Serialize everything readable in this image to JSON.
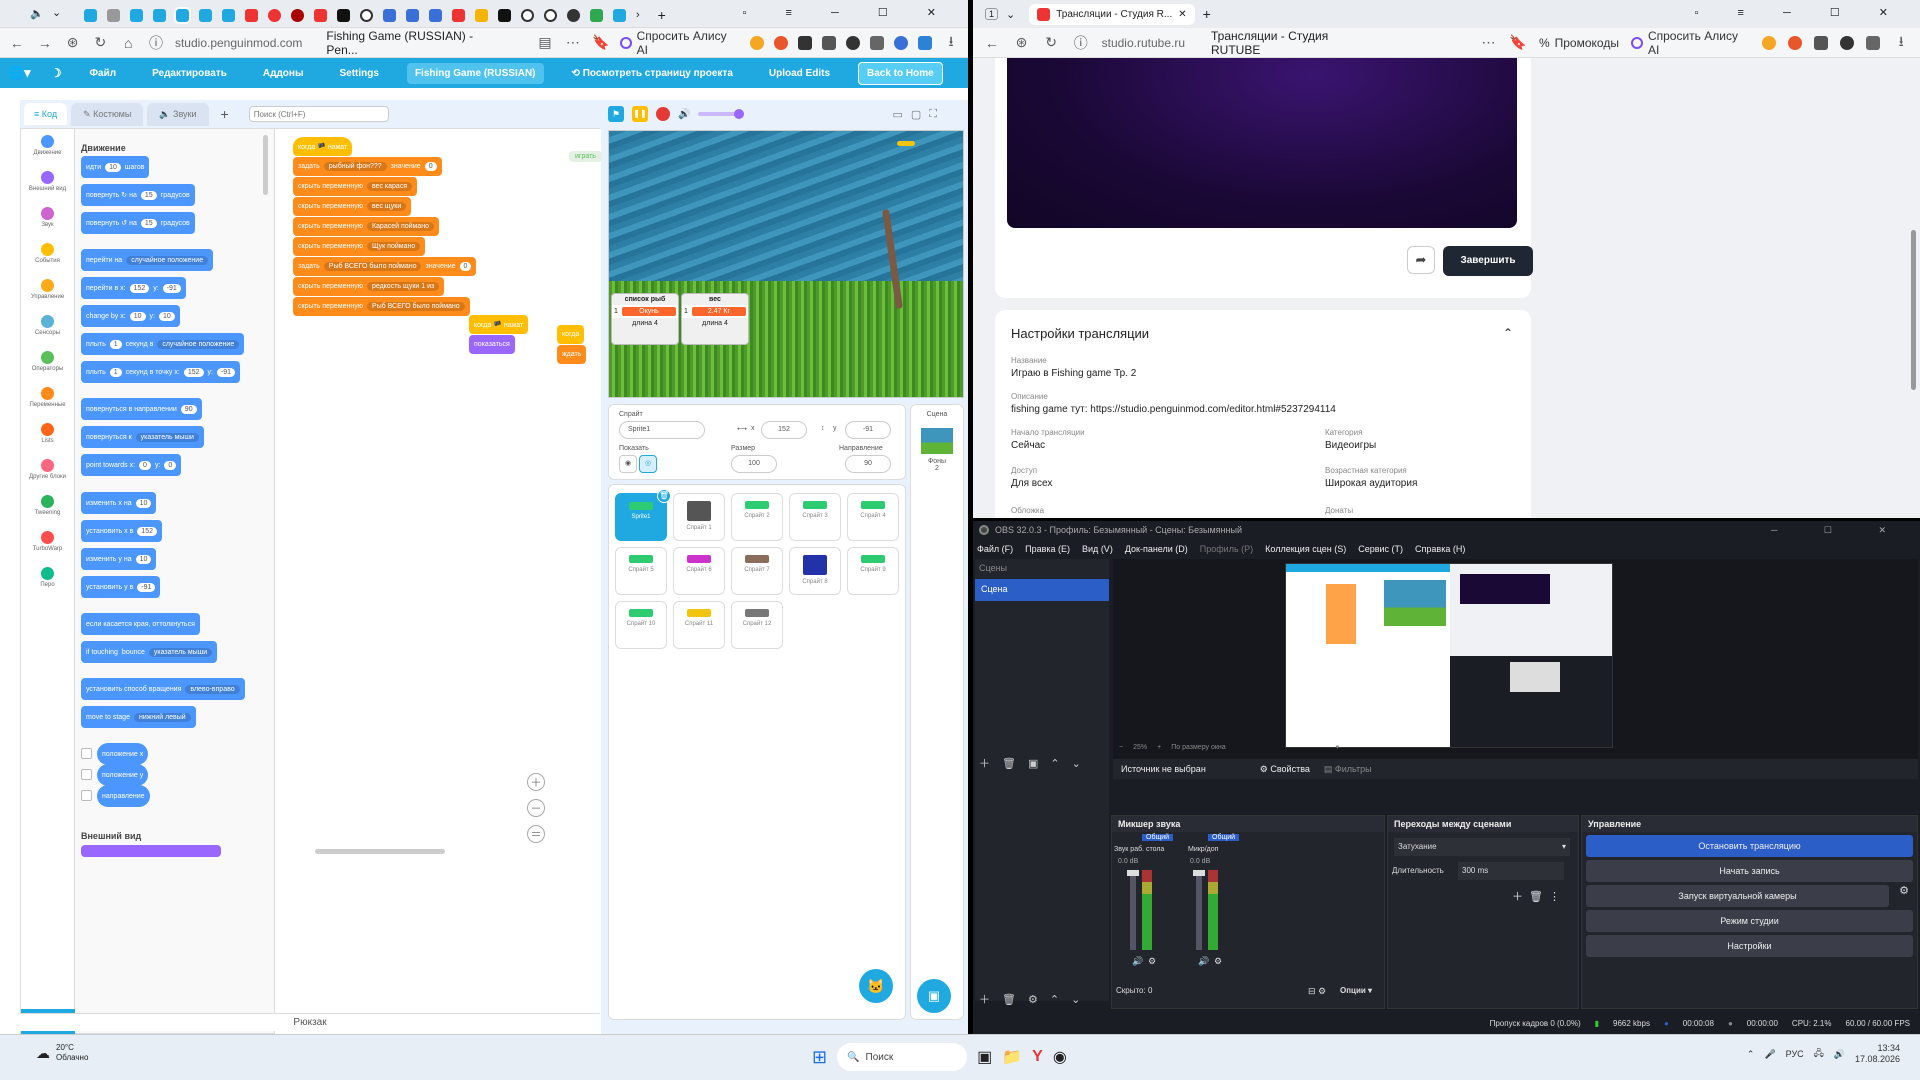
{
  "left_browser": {
    "tab_count_hint": "",
    "url": "studio.penguinmod.com",
    "page_title": "Fishing Game (RUSSIAN) - Pen...",
    "ask_alice": "Спросить Алису AI",
    "menu": {
      "file": "Файл",
      "edit": "Редактировать",
      "addons": "Аддоны",
      "settings": "Settings",
      "project_title": "Fishing Game (RUSSIAN)",
      "project_page": "Посмотреть страницу проекта",
      "upload": "Upload Edits",
      "back_home": "Back to Home"
    },
    "tabs": {
      "code": "Код",
      "costumes": "Костюмы",
      "sounds": "Звуки"
    },
    "search_placeholder": "Поиск (Ctrl+F)",
    "categories": [
      {
        "label": "Движение",
        "color": "#4c97ff"
      },
      {
        "label": "Внешний вид",
        "color": "#9966ff"
      },
      {
        "label": "Звук",
        "color": "#cf63cf"
      },
      {
        "label": "События",
        "color": "#ffbf00"
      },
      {
        "label": "Управление",
        "color": "#ffab19"
      },
      {
        "label": "Сенсоры",
        "color": "#5cb1d6"
      },
      {
        "label": "Операторы",
        "color": "#59c059"
      },
      {
        "label": "Переменные",
        "color": "#ff8c1a"
      },
      {
        "label": "Lists",
        "color": "#ff661a"
      },
      {
        "label": "Другие блоки",
        "color": "#ff6680"
      },
      {
        "label": "Tweening",
        "color": "#29b35b"
      },
      {
        "label": "TurboWarp",
        "color": "#ff4c4c"
      },
      {
        "label": "Перо",
        "color": "#0fbd8c"
      }
    ],
    "palette_heading": "Движение",
    "palette_blocks": [
      {
        "text": "идти",
        "v1": "10",
        "t2": "шагов"
      },
      {
        "text": "повернуть ↻ на",
        "v1": "15",
        "t2": "градусов"
      },
      {
        "text": "повернуть ↺ на",
        "v1": "15",
        "t2": "градусов"
      },
      {
        "text": "перейти на",
        "dd": "случайное положение"
      },
      {
        "text": "перейти в x:",
        "v1": "152",
        "t2": "y:",
        "v2": "-91"
      },
      {
        "text": "change by x:",
        "v1": "10",
        "t2": "y:",
        "v2": "10"
      },
      {
        "text": "плыть",
        "v1": "1",
        "t2": "секунд в",
        "dd": "случайное положение"
      },
      {
        "text": "плыть",
        "v1": "1",
        "t2": "секунд в точку x:",
        "v2": "152",
        "t3": "y:",
        "v3": "-91"
      },
      {
        "text": "повернуться в направлении",
        "v1": "90"
      },
      {
        "text": "повернуться к",
        "dd": "указатель мыши"
      },
      {
        "text": "point towards x:",
        "v1": "0",
        "t2": "y:",
        "v2": "0"
      },
      {
        "text": "изменить х на",
        "v1": "10"
      },
      {
        "text": "установить х в",
        "v1": "152"
      },
      {
        "text": "изменить у на",
        "v1": "10"
      },
      {
        "text": "установить у в",
        "v1": "-91"
      },
      {
        "text": "если касается края, оттолкнуться"
      },
      {
        "text": "if touching",
        "dd": "указатель мыши",
        "t2": "bounce"
      },
      {
        "text": "установить способ вращения",
        "dd": "влево-вправо"
      },
      {
        "text": "move to stage",
        "dd": "нижний левый"
      },
      {
        "text": "положение х"
      },
      {
        "text": "положение у"
      },
      {
        "text": "направление"
      }
    ],
    "palette_footer": "Внешний вид",
    "script": [
      {
        "text": "когда 🏴 нажат",
        "kind": "event"
      },
      {
        "text": "задать",
        "dd": "рыбный фон???",
        "t2": "значение",
        "v": "0"
      },
      {
        "text": "скрыть переменную",
        "dd": "вес карася"
      },
      {
        "text": "скрыть переменную",
        "dd": "вес щуки"
      },
      {
        "text": "скрыть переменную",
        "dd": "Карасей поймано"
      },
      {
        "text": "скрыть переменную",
        "dd": "Щук поймано"
      },
      {
        "text": "задать",
        "dd": "Рыб ВСЕГО было поймано",
        "t2": "значение",
        "v": "0"
      },
      {
        "text": "скрыть переменную",
        "dd": "редкость щуки 1 из"
      },
      {
        "text": "скрыть переменную",
        "dd": "Рыб ВСЕГО было поймано"
      }
    ],
    "script2": {
      "hat": "когда 🏴 нажат",
      "body": "показаться"
    },
    "script3": {
      "hat": "когда",
      "body": "ждать"
    },
    "play_tag": "играть",
    "monitors": {
      "list1_title": "список рыб",
      "list1_item": "Окунь",
      "list1_len": "длина 4",
      "list2_title": "вес",
      "list2_item": "2.47 Кг",
      "list2_len": "длина 4",
      "idx": "1"
    },
    "sprite_info": {
      "sprite_label": "Спрайт",
      "sprite_name": "Sprite1",
      "x_label": "x",
      "x_value": "152",
      "y_label": "y",
      "y_value": "-91",
      "show_label": "Показать",
      "size_label": "Размер",
      "size_value": "100",
      "dir_label": "Направление",
      "dir_value": "90",
      "stage_label": "Сцена",
      "backdrops_label": "Фоны",
      "backdrops_count": "2"
    },
    "sprites": [
      "Sprite1",
      "Спрайт 1",
      "Спрайт 2",
      "Спрайт 3",
      "Спрайт 4",
      "Спрайт 5",
      "Спрайт 6",
      "Спрайт 7",
      "Спрайт 8",
      "Спрайт 9",
      "Спрайт 10",
      "Спрайт 11",
      "Спрайт 12"
    ],
    "backpack": "Рюкзак"
  },
  "right_browser": {
    "tab_count": "1",
    "tab_title": "Трансляции - Студия R...",
    "url": "studio.rutube.ru",
    "page_title": "Трансляции - Студия RUTUBE",
    "promo": "Промокоды",
    "ask_alice": "Спросить Алису AI",
    "finish_button": "Завершить",
    "settings_title": "Настройки трансляции",
    "fields": {
      "name_label": "Название",
      "name_value": "Играю в Fishing game Тр. 2",
      "desc_label": "Описание",
      "desc_value": "fishing game тут: https://studio.penguinmod.com/editor.html#5237294114",
      "start_label": "Начало трансляции",
      "start_value": "Сейчас",
      "category_label": "Категория",
      "category_value": "Видеоигры",
      "access_label": "Доступ",
      "access_value": "Для всех",
      "age_label": "Возрастная категория",
      "age_value": "Широкая аудитория",
      "cover_label": "Обложка",
      "donate_label": "Донаты"
    }
  },
  "obs": {
    "title": "OBS 32.0.3 - Профиль: Безымянный - Сцены: Безымянный",
    "menu": [
      "Файл (F)",
      "Правка (E)",
      "Вид (V)",
      "Док-панели (D)",
      "Профиль (P)",
      "Коллекция сцен (S)",
      "Сервис (T)",
      "Справка (H)"
    ],
    "scenes_label": "Сцены",
    "scene_item": "Сцена",
    "zoom": "25%",
    "fit": "По размеру окна",
    "no_source": "Источник не выбран",
    "properties": "Свойства",
    "filters": "Фильтры",
    "mixer_title": "Микшер звука",
    "ch1_tag": "Общий",
    "ch1_name": "Звук раб. стола",
    "ch2_tag": "Общий",
    "ch2_name": "Микр/доп",
    "db1": "0.0 dB",
    "db2": "0.0 dB",
    "transitions_title": "Переходы между сценами",
    "transition": "Затухание",
    "duration_label": "Длительность",
    "duration_value": "300 ms",
    "controls_title": "Управление",
    "stop_stream": "Остановить трансляцию",
    "start_record": "Начать запись",
    "virtual_cam": "Запуск виртуальной камеры",
    "studio_mode": "Режим студии",
    "settings": "Настройки",
    "hidden": "Скрыто: 0",
    "options": "Опции",
    "status": {
      "dropped": "Пропуск кадров 0 (0.0%)",
      "kbps": "9662 kbps",
      "stream_time": "00:00:08",
      "rec_time": "00:00:00",
      "cpu": "CPU: 2.1%",
      "fps": "60.00 / 60.00 FPS"
    }
  },
  "taskbar": {
    "weather_temp": "20°C",
    "weather_desc": "Облачно",
    "search": "Поиск",
    "lang": "РУС",
    "time": "13:34",
    "date": "17.08.2026"
  }
}
